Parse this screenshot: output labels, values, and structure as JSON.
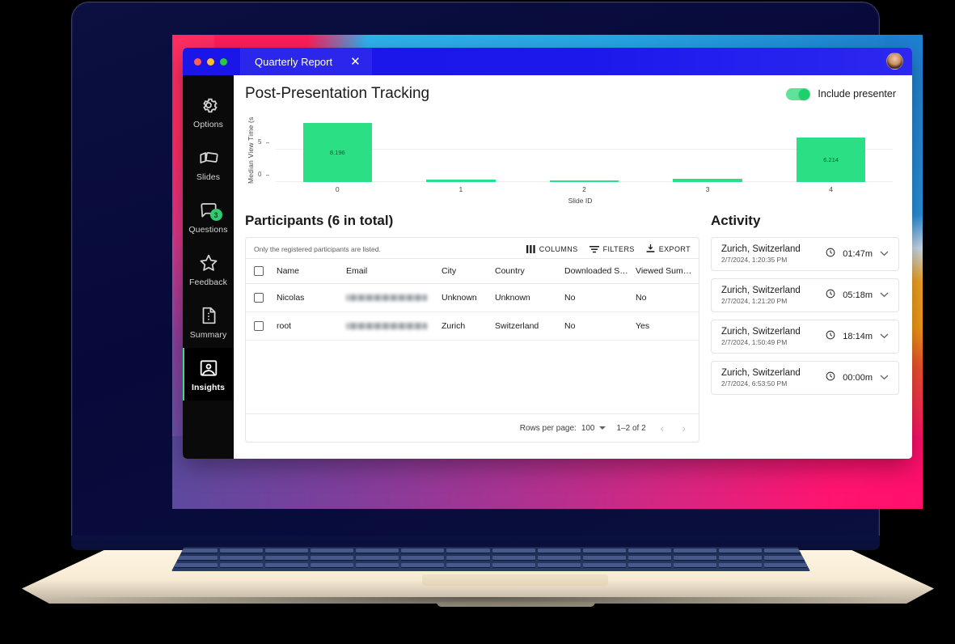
{
  "window": {
    "tab_title": "Quarterly Report",
    "close_label": "✕",
    "traffic_lights": [
      "close",
      "minimize",
      "maximize"
    ]
  },
  "sidebar": {
    "items": [
      {
        "label": "Options",
        "icon": "gear-icon",
        "active": false,
        "badge": null
      },
      {
        "label": "Slides",
        "icon": "slides-icon",
        "active": false,
        "badge": null
      },
      {
        "label": "Questions",
        "icon": "chat-bubble-icon",
        "active": false,
        "badge": "3"
      },
      {
        "label": "Feedback",
        "icon": "star-icon",
        "active": false,
        "badge": null
      },
      {
        "label": "Summary",
        "icon": "document-icon",
        "active": false,
        "badge": null
      },
      {
        "label": "Insights",
        "icon": "insights-icon",
        "active": true,
        "badge": null
      }
    ]
  },
  "header": {
    "page_title": "Post-Presentation Tracking",
    "toggle_label": "Include presenter",
    "toggle_on": true,
    "toggle_color": "#19d26b"
  },
  "chart_data": {
    "type": "bar",
    "title": "",
    "xlabel": "Slide ID",
    "ylabel": "Median View Time (s",
    "categories": [
      "0",
      "1",
      "2",
      "3",
      "4"
    ],
    "values": [
      8.196,
      0.3,
      0.2,
      0.5,
      6.214
    ],
    "bar_labels": [
      "8.196",
      "",
      "",
      "",
      "6.214"
    ],
    "ytick_labels": [
      "0",
      "5"
    ],
    "ytick_values": [
      0,
      5
    ],
    "ylim": [
      0,
      9
    ],
    "grid": true,
    "legend": "none",
    "bar_color": "#2bdf85"
  },
  "participants": {
    "title": "Participants (6 in total)",
    "hint": "Only the registered participants are listed.",
    "toolbar": [
      {
        "label": "COLUMNS",
        "icon": "columns-icon"
      },
      {
        "label": "FILTERS",
        "icon": "filter-icon"
      },
      {
        "label": "EXPORT",
        "icon": "download-icon"
      }
    ],
    "columns": [
      "Name",
      "Email",
      "City",
      "Country",
      "Downloaded Sl…",
      "Viewed Summ…"
    ],
    "rows": [
      {
        "name": "Nicolas",
        "email": "",
        "city": "Unknown",
        "country": "Unknown",
        "downloaded": "No",
        "viewed": "No"
      },
      {
        "name": "root",
        "email": "",
        "city": "Zurich",
        "country": "Switzerland",
        "downloaded": "No",
        "viewed": "Yes"
      }
    ],
    "footer": {
      "rows_per_page_label": "Rows per page:",
      "rows_per_page_value": "100",
      "range_label": "1–2 of 2",
      "prev_label": "‹",
      "next_label": "›"
    }
  },
  "activity": {
    "title": "Activity",
    "items": [
      {
        "place": "Zurich, Switzerland",
        "when": "2/7/2024, 1:20:35 PM",
        "duration": "01:47m"
      },
      {
        "place": "Zurich, Switzerland",
        "when": "2/7/2024, 1:21:20 PM",
        "duration": "05:18m"
      },
      {
        "place": "Zurich, Switzerland",
        "when": "2/7/2024, 1:50:49 PM",
        "duration": "18:14m"
      },
      {
        "place": "Zurich, Switzerland",
        "when": "2/7/2024, 6:53:50 PM",
        "duration": "00:00m"
      }
    ],
    "chevron": "⌄"
  }
}
